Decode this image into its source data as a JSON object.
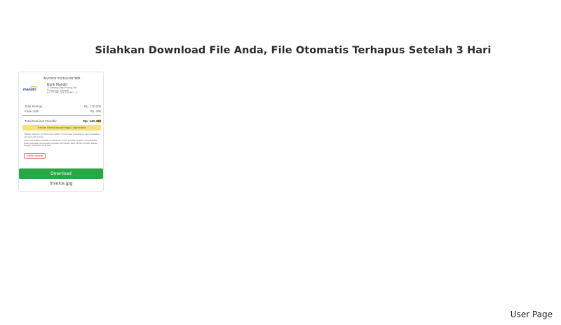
{
  "page": {
    "title": "Silahkan Download File Anda, File Otomatis Terhapus Setelah 3 Hari"
  },
  "file_card": {
    "invoice": {
      "title": "INVOICE #22115-D57869",
      "bank_logo": "mandiri",
      "bank_name": "Bank Mandiri",
      "bank_address_1": "Jl. Siliwangi Pasir Pinang, Kec",
      "bank_address_2": "Padalarang, Sukaasih",
      "bank_account": "a.n. PT ABC DEF 1234567 - 8",
      "rows": [
        {
          "label": "Total Belanja",
          "value": "Rp. 140.000"
        },
        {
          "label": "Kode Unik",
          "value": "Rp. 498"
        }
      ],
      "total_label": "Total Nominal Transfer",
      "total_value_main": "Rp. 140.4",
      "total_value_highlight": "98",
      "notice": "Transfer nominal sesuai hingga 3 digit terakhir",
      "note_1": "Transfer Sebelum 15 November 2022 17:19:43 atau transaksimu akan dibatalkan otomatis oleh system.",
      "note_2": "Kode Unik adalah identitas pembayaran Anda. Transfer dengan menambahkan Kode Unik akan memproses otomatis oleh sistem kami. Mohon transfer sesuai dengan Total Nominal di atas.",
      "button": "Unduh Invoice"
    },
    "download_label": "Download",
    "file_name": "invoice.jpg"
  },
  "footer": {
    "label": "User Page"
  }
}
